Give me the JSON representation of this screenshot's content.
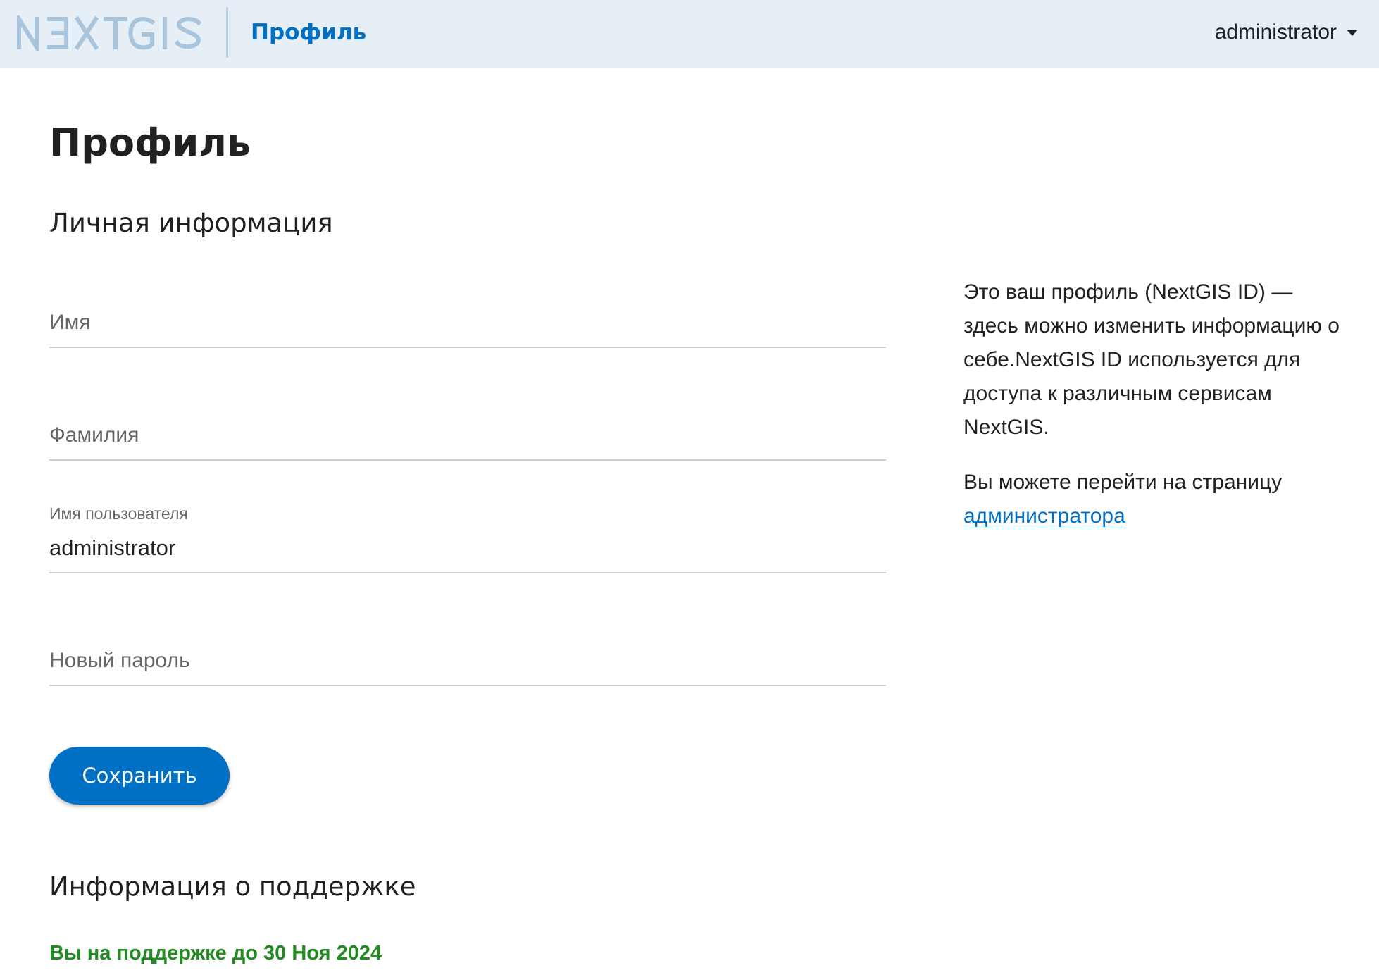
{
  "header": {
    "logo_text": "NEXTGIS",
    "nav_link": "Профиль",
    "user_menu_label": "administrator"
  },
  "page": {
    "title": "Профиль"
  },
  "personal_info": {
    "section_title": "Личная информация",
    "first_name": {
      "placeholder": "Имя",
      "value": ""
    },
    "last_name": {
      "placeholder": "Фамилия",
      "value": ""
    },
    "username": {
      "label": "Имя пользователя",
      "value": "administrator"
    },
    "new_password": {
      "placeholder": "Новый пароль",
      "value": ""
    },
    "save_label": "Сохранить"
  },
  "support": {
    "section_title": "Информация о поддержке",
    "status_text": "Вы на поддержке до 30 Ноя 2024"
  },
  "aside": {
    "description": "Это ваш профиль (NextGIS ID) — здесь можно изменить информацию о себе.NextGIS ID используется для доступа к различным сервисам NextGIS.",
    "admin_prompt": "Вы можете перейти на страницу",
    "admin_link": "администратора"
  },
  "colors": {
    "accent": "#0070c5",
    "header_bg": "#e6eef6",
    "support_ok": "#228b22",
    "logo": "#a9c4dd"
  }
}
